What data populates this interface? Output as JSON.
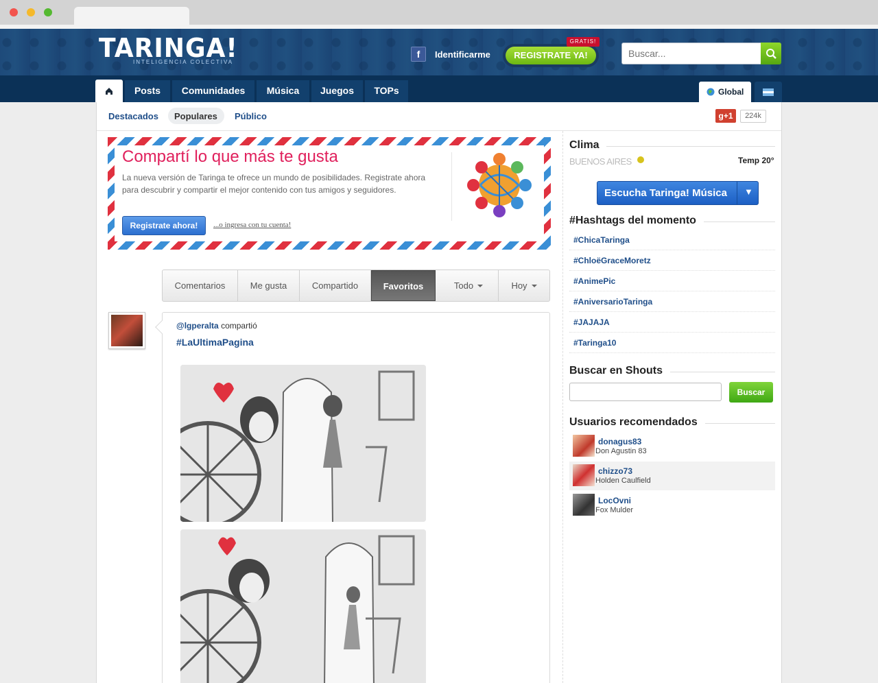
{
  "brand": {
    "logo": "TARINGA!",
    "tagline": "INTELIGENCIA COLECTIVA"
  },
  "header": {
    "facebook_glyph": "f",
    "identify_label": "Identificarme",
    "register_label": "REGISTRATE YA!",
    "gratis_label": "GRATIS!",
    "search_placeholder": "Buscar..."
  },
  "nav": {
    "items": [
      "Posts",
      "Comunidades",
      "Música",
      "Juegos",
      "TOPs"
    ],
    "global_label": "Global"
  },
  "subnav": {
    "items": [
      "Destacados",
      "Populares",
      "Público"
    ],
    "selected": "Populares",
    "gplus_label": "g+1",
    "gplus_count": "224k"
  },
  "banner": {
    "title": "Compartí lo que más te gusta",
    "text": "La nueva versión de Taringa te ofrece un mundo de posibilidades. Registrate ahora para descubrir y compartir el mejor contenido con tus amigos y seguidores.",
    "button": "Registrate ahora!",
    "link": "...o ingresa con tu cuenta!"
  },
  "filters": {
    "tabs": [
      "Comentarios",
      "Me gusta",
      "Compartido",
      "Favoritos",
      "Todo",
      "Hoy"
    ],
    "active": "Favoritos"
  },
  "post": {
    "user": "@lgperalta",
    "action": "compartió",
    "hashtag": "#LaUltimaPagina"
  },
  "sidebar": {
    "clima": {
      "title": "Clima",
      "city": "BUENOS AIRES",
      "temp": "Temp 20°"
    },
    "musica_button": "Escucha Taringa! Música",
    "hashtags_title": "#Hashtags del momento",
    "hashtags": [
      "#ChicaTaringa",
      "#ChloëGraceMoretz",
      "#AnimePic",
      "#AniversarioTaringa",
      "#JAJAJA",
      "#Taringa10"
    ],
    "shouts_title": "Buscar en Shouts",
    "shouts_button": "Buscar",
    "users_title": "Usuarios recomendados",
    "users": [
      {
        "name": "donagus83",
        "real": "Don Agustin 83"
      },
      {
        "name": "chizzo73",
        "real": "Holden Caulfield"
      },
      {
        "name": "LocOvni",
        "real": "Fox Mulder"
      }
    ]
  },
  "colors": {
    "header_blue": "#1e4a7a",
    "nav_blue": "#0b3157",
    "link_blue": "#1f4e89",
    "accent_pink": "#e0205c",
    "green": "#6cb813"
  },
  "icons": [
    "home-icon",
    "facebook-icon",
    "search-icon",
    "globe-icon",
    "argentina-flag-icon",
    "weather-sun-icon",
    "chevron-down-icon"
  ]
}
